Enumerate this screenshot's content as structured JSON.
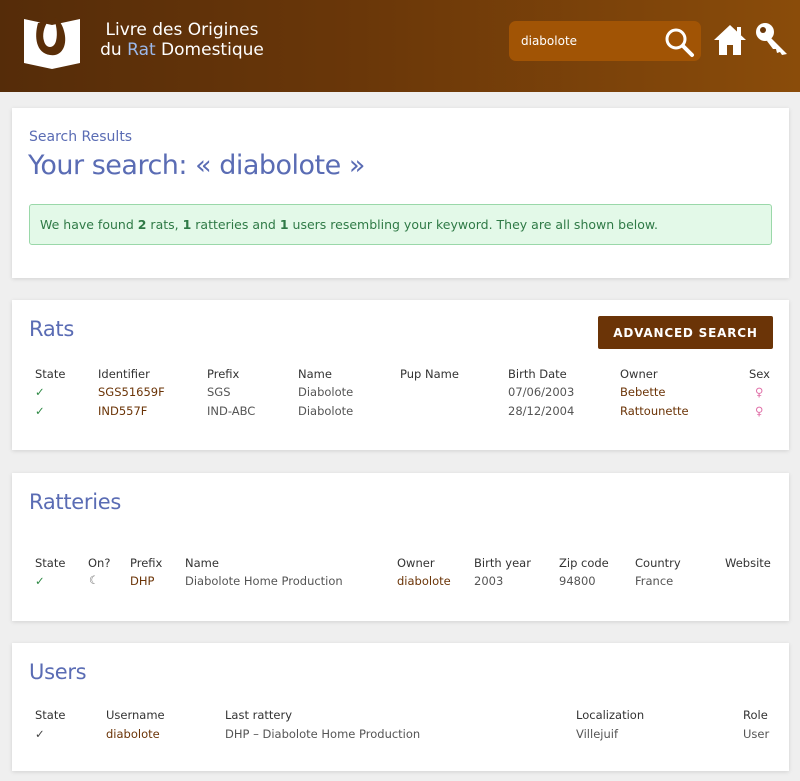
{
  "header": {
    "title_line1": "Livre des Origines",
    "title_line2_prefix": "du ",
    "title_line2_rat": "Rat",
    "title_line2_suffix": " Domestique",
    "search_value": "diabolote",
    "colors": {
      "header_start": "#552c09",
      "header_end": "#8a4c0a",
      "search_bg": "#a15405"
    },
    "icons": {
      "logo": "book-logo-icon",
      "search": "search-icon",
      "home": "home-icon",
      "login": "key-icon"
    }
  },
  "search": {
    "kicker": "Search Results",
    "title": "Your search: « diabolote »",
    "alert": {
      "p1": "We have found ",
      "rats_count": "2",
      "p2": " rats, ",
      "ratteries_count": "1",
      "p3": " ratteries and ",
      "users_count": "1",
      "p4": " users resembling your keyword. They are all shown below."
    }
  },
  "rats": {
    "title": "Rats",
    "advanced_button": "ADVANCED SEARCH",
    "headers": [
      "State",
      "Identifier",
      "Prefix",
      "Name",
      "Pup Name",
      "Birth Date",
      "Owner",
      "Sex"
    ],
    "rows": [
      {
        "state": "✓",
        "identifier": "SGS51659F",
        "prefix": "SGS",
        "name": "Diabolote",
        "pup_name": "",
        "birth_date": "07/06/2003",
        "owner": "Bebette",
        "sex": "♀"
      },
      {
        "state": "✓",
        "identifier": "IND557F",
        "prefix": "IND-ABC",
        "name": "Diabolote",
        "pup_name": "",
        "birth_date": "28/12/2004",
        "owner": "Rattounette",
        "sex": "♀"
      }
    ]
  },
  "ratteries": {
    "title": "Ratteries",
    "headers": [
      "State",
      "On?",
      "Prefix",
      "Name",
      "Owner",
      "Birth year",
      "Zip code",
      "Country",
      "Website"
    ],
    "rows": [
      {
        "state": "✓",
        "on": "☾",
        "prefix": "DHP",
        "name": "Diabolote Home Production",
        "owner": "diabolote",
        "birth_year": "2003",
        "zip": "94800",
        "country": "France",
        "website": ""
      }
    ]
  },
  "users": {
    "title": "Users",
    "headers": [
      "State",
      "Username",
      "Last rattery",
      "Localization",
      "Role"
    ],
    "rows": [
      {
        "state": "✓",
        "username": "diabolote",
        "last_rattery": "DHP – Diabolote Home Production",
        "localization": "Villejuif",
        "role": "User"
      }
    ]
  }
}
